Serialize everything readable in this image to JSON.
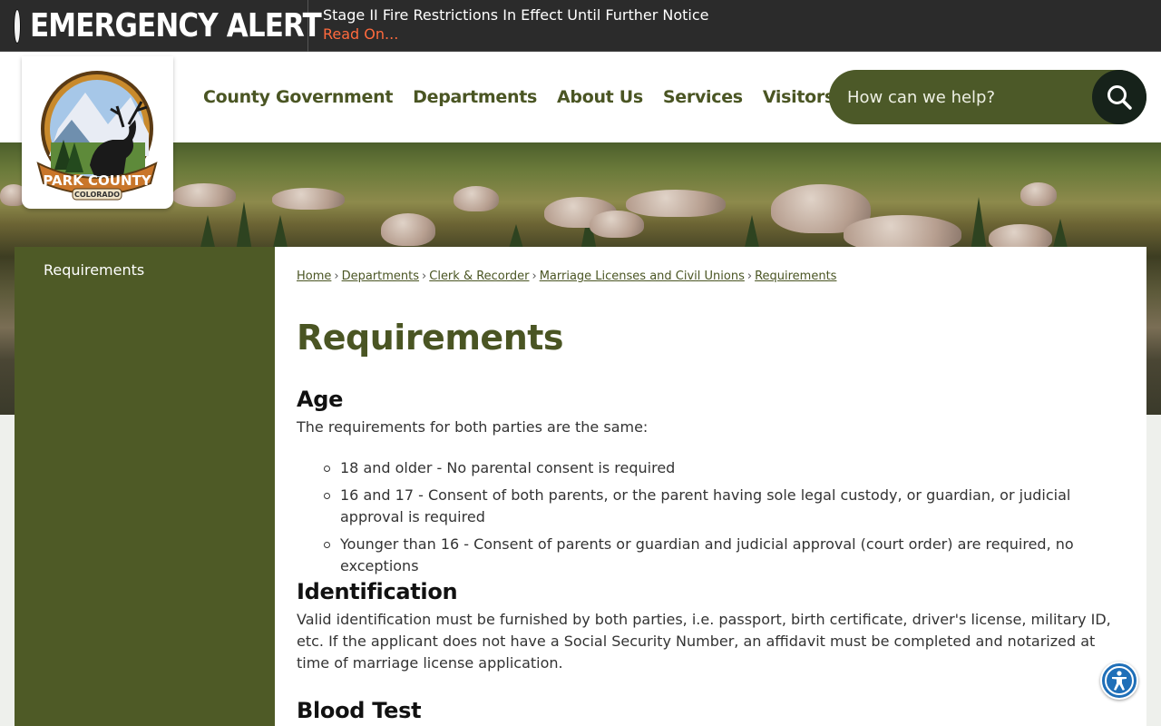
{
  "alert": {
    "title": "EMERGENCY ALERT",
    "message": "Stage II Fire Restrictions In Effect Until Further Notice",
    "link_label": "Read On..."
  },
  "logo": {
    "line1": "PARK COUNTY",
    "line2": "COLORADO"
  },
  "nav": {
    "items": [
      "County Government",
      "Departments",
      "About Us",
      "Services",
      "Visitors"
    ]
  },
  "search": {
    "placeholder": "How can we help?"
  },
  "sidebar": {
    "items": [
      "Requirements"
    ]
  },
  "breadcrumb": [
    "Home",
    "Departments",
    "Clerk & Recorder",
    "Marriage Licenses and Civil Unions",
    "Requirements"
  ],
  "content": {
    "title": "Requirements",
    "age_heading": "Age",
    "age_intro": "The requirements for both parties are the same:",
    "age_items": [
      "18 and older - No parental consent is required",
      "16 and 17 - Consent of both parents, or the parent having sole legal custody, or guardian, or judicial approval is required",
      "Younger than 16 - Consent of parents or guardian and judicial approval (court order) are required, no exceptions"
    ],
    "id_heading": "Identification",
    "id_text": "Valid identification must be furnished by both parties, i.e. passport, birth certificate, driver's license, military ID, etc. If the applicant does not have a Social Security Number, an affidavit must be completed and notarized at time of marriage license application.",
    "blood_heading": "Blood Test"
  },
  "icons": {
    "alert": "alert-dot-icon",
    "search": "search-icon",
    "accessibility": "accessibility-icon"
  },
  "colors": {
    "brand_green": "#4a5523",
    "sidebar": "#4e5a26",
    "alert_bg": "#2b2b2b",
    "alert_link": "#ff6a3d",
    "accessibility_blue": "#1f6fb8"
  }
}
